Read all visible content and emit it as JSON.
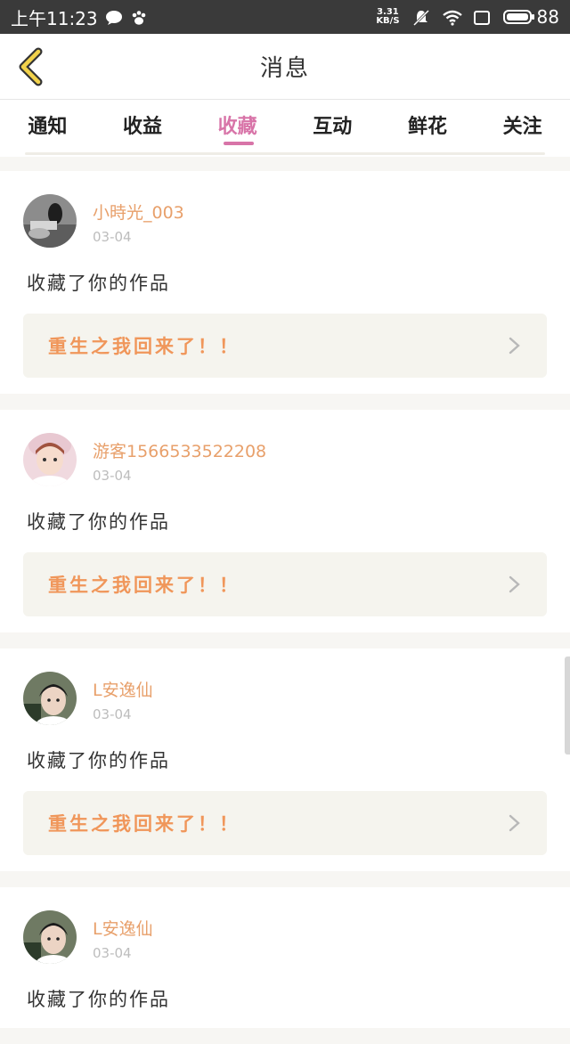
{
  "status_bar": {
    "time": "上午11:23",
    "net_speed_value": "3.31",
    "net_speed_unit": "KB/S",
    "battery": "88"
  },
  "header": {
    "title": "消息"
  },
  "tabs": [
    {
      "label": "通知"
    },
    {
      "label": "收益"
    },
    {
      "label": "收藏"
    },
    {
      "label": "互动"
    },
    {
      "label": "鲜花"
    },
    {
      "label": "关注"
    }
  ],
  "active_tab": "收藏",
  "messages": [
    {
      "username": "小時光_003",
      "date": "03-04",
      "action": "收藏了你的作品",
      "work_title": "重生之我回来了！！"
    },
    {
      "username": "游客1566533522208",
      "date": "03-04",
      "action": "收藏了你的作品",
      "work_title": "重生之我回来了！！"
    },
    {
      "username": "L安逸仙",
      "date": "03-04",
      "action": "收藏了你的作品",
      "work_title": "重生之我回来了！！"
    },
    {
      "username": "L安逸仙",
      "date": "03-04",
      "action": "收藏了你的作品"
    }
  ],
  "colors": {
    "accent_pink": "#d874a8",
    "username_orange": "#e8a06b",
    "work_title_orange": "#f0965a",
    "back_arrow_yellow": "#f2d24b"
  }
}
